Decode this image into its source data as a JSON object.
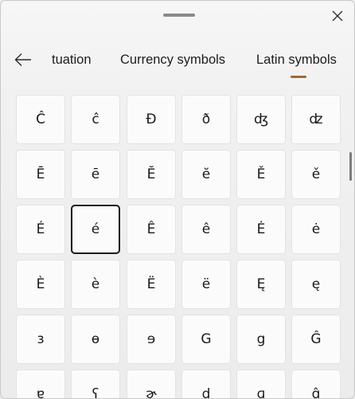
{
  "header": {
    "close_icon": "close-icon",
    "back_icon": "back-arrow-icon"
  },
  "tabs": [
    {
      "label": "tuation"
    },
    {
      "label": "Currency symbols"
    },
    {
      "label": "Latin symbols",
      "selected": true
    }
  ],
  "accent_color": "#9c6a3e",
  "selected_symbol": "é",
  "symbols": [
    [
      "Ĉ",
      "ĉ",
      "Đ",
      "ð",
      "ʤ",
      "ʣ"
    ],
    [
      "Ē",
      "ē",
      "Ĕ",
      "ĕ",
      "Ě",
      "ě"
    ],
    [
      "É",
      "é",
      "Ê",
      "ê",
      "Ė",
      "ė"
    ],
    [
      "È",
      "è",
      "Ë",
      "ë",
      "Ę",
      "ę"
    ],
    [
      "ɜ",
      "ɵ",
      "ɘ",
      "G",
      "g",
      "Ĝ"
    ],
    [
      "ɐ",
      "ʕ",
      "ɚ",
      "ɖ",
      "ɡ",
      "ĝ"
    ]
  ]
}
